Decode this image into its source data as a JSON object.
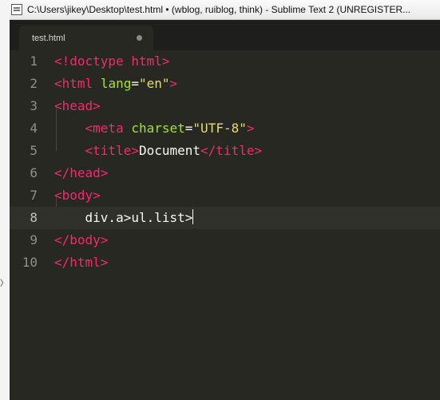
{
  "window": {
    "title": "C:\\Users\\jikey\\Desktop\\test.html • (wblog, ruiblog, think) - Sublime Text 2 (UNREGISTER..."
  },
  "tabs": [
    {
      "label": "test.html",
      "modified_indicator": "dirty-dot-icon"
    }
  ],
  "editor": {
    "line_numbers": [
      "1",
      "2",
      "3",
      "4",
      "5",
      "6",
      "7",
      "8",
      "9",
      "10"
    ],
    "active_line": 8,
    "lines": [
      {
        "open": "<!doctype html",
        "close": ">"
      },
      {
        "open": "<html",
        "attr": "lang",
        "eq": "=",
        "value": "\"en\"",
        "close": ">"
      },
      {
        "open": "<head",
        "close": ">"
      },
      {
        "indent": "    ",
        "open": "<meta",
        "attr": "charset",
        "eq": "=",
        "value": "\"UTF-8\"",
        "close": ">"
      },
      {
        "indent": "    ",
        "open": "<title",
        "close": ">",
        "text": "Document",
        "end": "</title>"
      },
      {
        "open": "</head",
        "close": ">"
      },
      {
        "open": "<body",
        "close": ">"
      },
      {
        "indent": "    ",
        "text": "div.a>ul.list>"
      },
      {
        "open": "</body",
        "close": ">"
      },
      {
        "open": "</html",
        "close": ">"
      }
    ]
  },
  "colors": {
    "background": "#272822",
    "tag": "#f92672",
    "attribute": "#a6e22e",
    "string": "#e6db74",
    "text": "#f8f8f2",
    "gutter": "#8f908a"
  }
}
